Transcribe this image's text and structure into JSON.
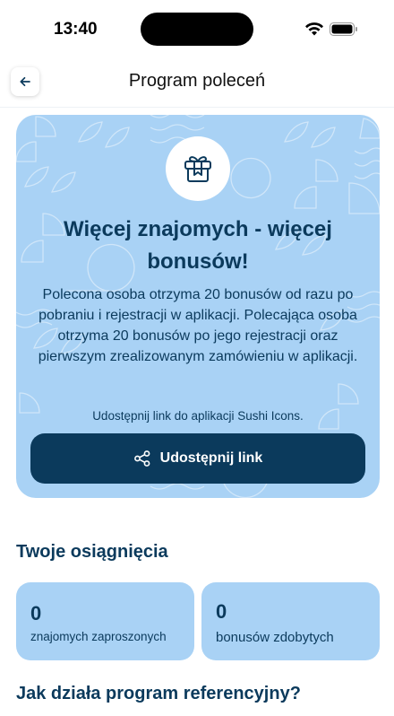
{
  "status_bar": {
    "time": "13:40"
  },
  "nav": {
    "title": "Program poleceń"
  },
  "hero": {
    "title": "Więcej znajomych - więcej bonusów!",
    "description": "Polecona osoba otrzyma 20 bonusów od razu po pobraniu i rejestracji w aplikacji. Polecająca osoba otrzyma 20 bonusów po jego rejestracji oraz pierwszym zrealizowanym zamówieniu w aplikacji.",
    "note": "Udostępnij link do aplikacji Sushi Icons.",
    "share_button": "Udostępnij link"
  },
  "achievements": {
    "title": "Twoje osiągnięcia",
    "stats": [
      {
        "value": "0",
        "label": "znajomych zaproszonych"
      },
      {
        "value": "0",
        "label": "bonusów zdobytych"
      }
    ]
  },
  "how_it_works": {
    "title": "Jak działa program referencyjny?"
  },
  "colors": {
    "primary": "#0b3a5c",
    "card": "#a9d2f5",
    "background": "#ffffff"
  }
}
